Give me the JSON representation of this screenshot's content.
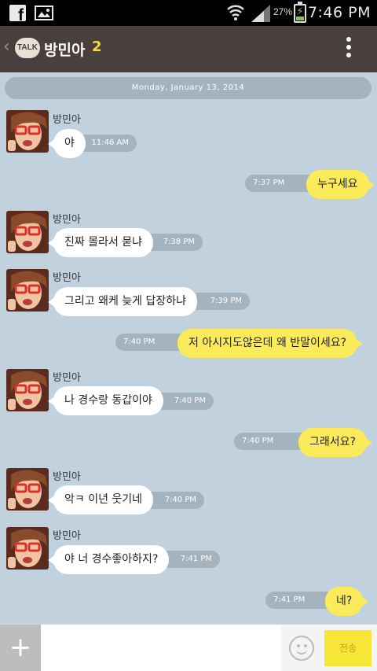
{
  "status_bar": {
    "battery_percent": "27%",
    "battery_level": 0.27,
    "time": "7:46 PM",
    "icons": [
      "facebook-icon",
      "gallery-icon",
      "wifi-icon",
      "signal-icon",
      "battery-icon"
    ]
  },
  "header": {
    "logo": "TALK",
    "title": "방민아",
    "member_count": "2"
  },
  "date_divider": "Monday, January 13, 2014",
  "messages": [
    {
      "dir": "in",
      "sender": "방민아",
      "text": "야",
      "time": "11:46 AM"
    },
    {
      "dir": "out",
      "text": "누구세요",
      "time": "7:37 PM"
    },
    {
      "dir": "in",
      "sender": "방민아",
      "text": "진짜 몰라서 묻냐",
      "time": "7:38 PM"
    },
    {
      "dir": "in",
      "sender": "방민아",
      "text": "그리고 왜케 늦게 답장하냐",
      "time": "7:39 PM"
    },
    {
      "dir": "out",
      "text": "저 아시지도않은데 왜 반말이세요?",
      "time": "7:40 PM"
    },
    {
      "dir": "in",
      "sender": "방민아",
      "text": "나 경수랑 동갑이야",
      "time": "7:40 PM"
    },
    {
      "dir": "out",
      "text": "그래서요?",
      "time": "7:40 PM"
    },
    {
      "dir": "in",
      "sender": "방민아",
      "text": "악ㅋ 이년 웃기네",
      "time": "7:40 PM"
    },
    {
      "dir": "in",
      "sender": "방민아",
      "text": "야 너 경수좋아하지?",
      "time": "7:41 PM"
    },
    {
      "dir": "out",
      "text": "네?",
      "time": "7:41 PM"
    }
  ],
  "input_bar": {
    "plus_label": "+",
    "send_label": "전송",
    "message_value": ""
  },
  "colors": {
    "chat_background": "#c1d1de",
    "header_background": "#4a3f3f",
    "outgoing_bubble": "#fbeb5b",
    "incoming_bubble": "#ffffff",
    "timestamp_pill": "#a5b3bf",
    "member_count": "#f5dd3d"
  }
}
